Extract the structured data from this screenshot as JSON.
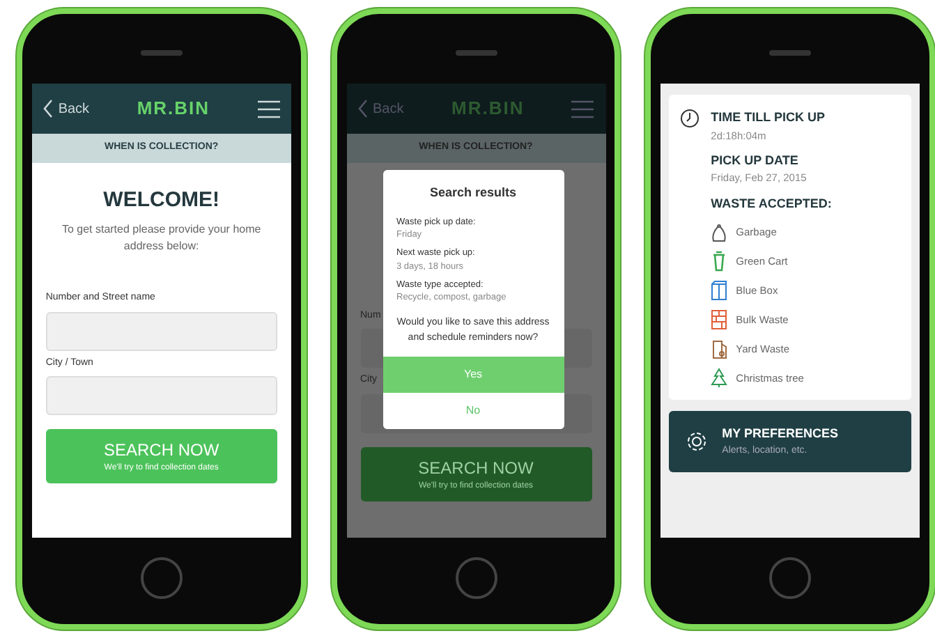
{
  "phones": [
    {
      "kind": "address-form",
      "nav": {
        "back": "Back",
        "logo": "MR.BIN"
      },
      "subtitle": "WHEN IS COLLECTION?",
      "heading": "WELCOME!",
      "intro": "To get started please provide your home address below:",
      "fields": [
        {
          "label": "Number and Street name"
        },
        {
          "label": "City / Town"
        }
      ],
      "button": {
        "title": "SEARCH NOW",
        "caption": "We'll try to find collection dates"
      }
    },
    {
      "kind": "results-dialog",
      "nav": {
        "back": "Back",
        "logo": "MR.BIN"
      },
      "subtitle": "WHEN IS COLLECTION?",
      "fields": [
        {
          "label": "Num"
        },
        {
          "label": "City"
        }
      ],
      "button": {
        "title": "SEARCH NOW",
        "caption": "We'll try to find collection dates"
      },
      "dialog": {
        "title": "Search results",
        "facts": [
          {
            "label": "Waste pick up date:",
            "value": "Friday"
          },
          {
            "label": "Next waste pick up:",
            "value": "3 days, 18 hours"
          },
          {
            "label": "Waste type accepted:",
            "value": "Recycle, compost, garbage"
          }
        ],
        "question": "Would you like to save this address and schedule reminders now?",
        "actions": [
          {
            "label": "Yes",
            "primary": true
          },
          {
            "label": "No",
            "primary": false
          }
        ]
      }
    },
    {
      "kind": "summary",
      "timer": {
        "label": "TIME TILL PICK UP",
        "value": "2d:18h:04m"
      },
      "pickup": {
        "label": "PICK UP DATE",
        "value": "Friday, Feb 27, 2015"
      },
      "waste_heading": "WASTE ACCEPTED:",
      "waste": [
        {
          "name": "Garbage",
          "kind": "bag",
          "color": "#555555"
        },
        {
          "name": "Green Cart",
          "kind": "cart",
          "color": "#3aa850"
        },
        {
          "name": "Blue Box",
          "kind": "box",
          "color": "#2f7fd0"
        },
        {
          "name": "Bulk Waste",
          "kind": "bulk",
          "color": "#e0603a"
        },
        {
          "name": "Yard Waste",
          "kind": "yard",
          "color": "#a06a40"
        },
        {
          "name": "Christmas tree",
          "kind": "tree",
          "color": "#2f9a55"
        }
      ],
      "preferences": {
        "title": "MY PREFERENCES",
        "subtitle": "Alerts, location, etc."
      }
    }
  ]
}
